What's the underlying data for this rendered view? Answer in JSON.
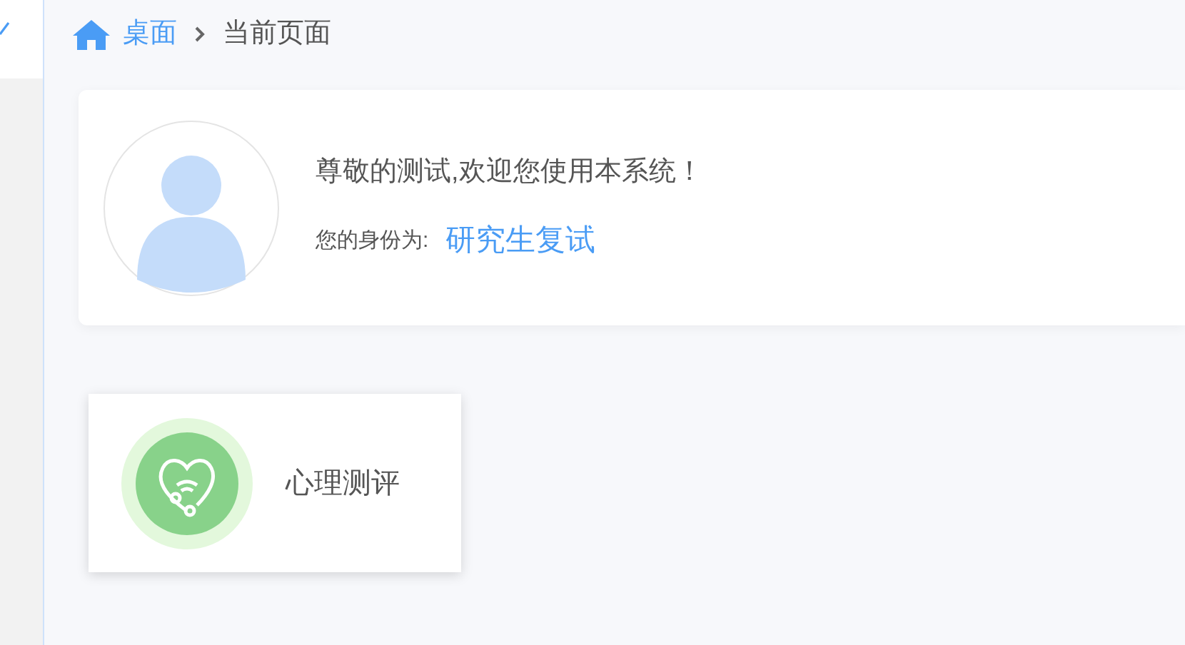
{
  "breadcrumb": {
    "items": [
      {
        "label": "桌面",
        "kind": "link"
      },
      {
        "label": "当前页面",
        "kind": "current"
      }
    ]
  },
  "welcome": {
    "greeting": "尊敬的测试,欢迎您使用本系统！",
    "role_label": "您的身份为:",
    "role": "研究生复试"
  },
  "tiles": [
    {
      "label": "心理测评"
    }
  ]
}
